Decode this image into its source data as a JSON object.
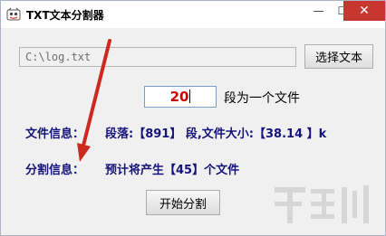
{
  "window": {
    "title": "TXT文本分割器",
    "minimize_glyph": "—",
    "maximize_glyph": "☐",
    "close_glyph": "✕"
  },
  "file": {
    "path": "C:\\log.txt",
    "select_button_label": "选择文本"
  },
  "split": {
    "paragraphs_per_file": "20",
    "per_file_suffix": "段为一个文件",
    "start_button_label": "开始分割"
  },
  "file_info": {
    "label": "文件信息：",
    "value": "段落:【891】 段,文件大小:【38.14 】k"
  },
  "split_info": {
    "label": "分割信息：",
    "value": "预计将产生【45】个文件"
  },
  "colors": {
    "arrow": "#cc2a1e",
    "info_text": "#14147a",
    "input_text": "#cc0000",
    "close_button": "#c7372f"
  },
  "icons": {
    "app": "txt-splitter-app-icon",
    "watermark": "site-watermark-logo"
  }
}
